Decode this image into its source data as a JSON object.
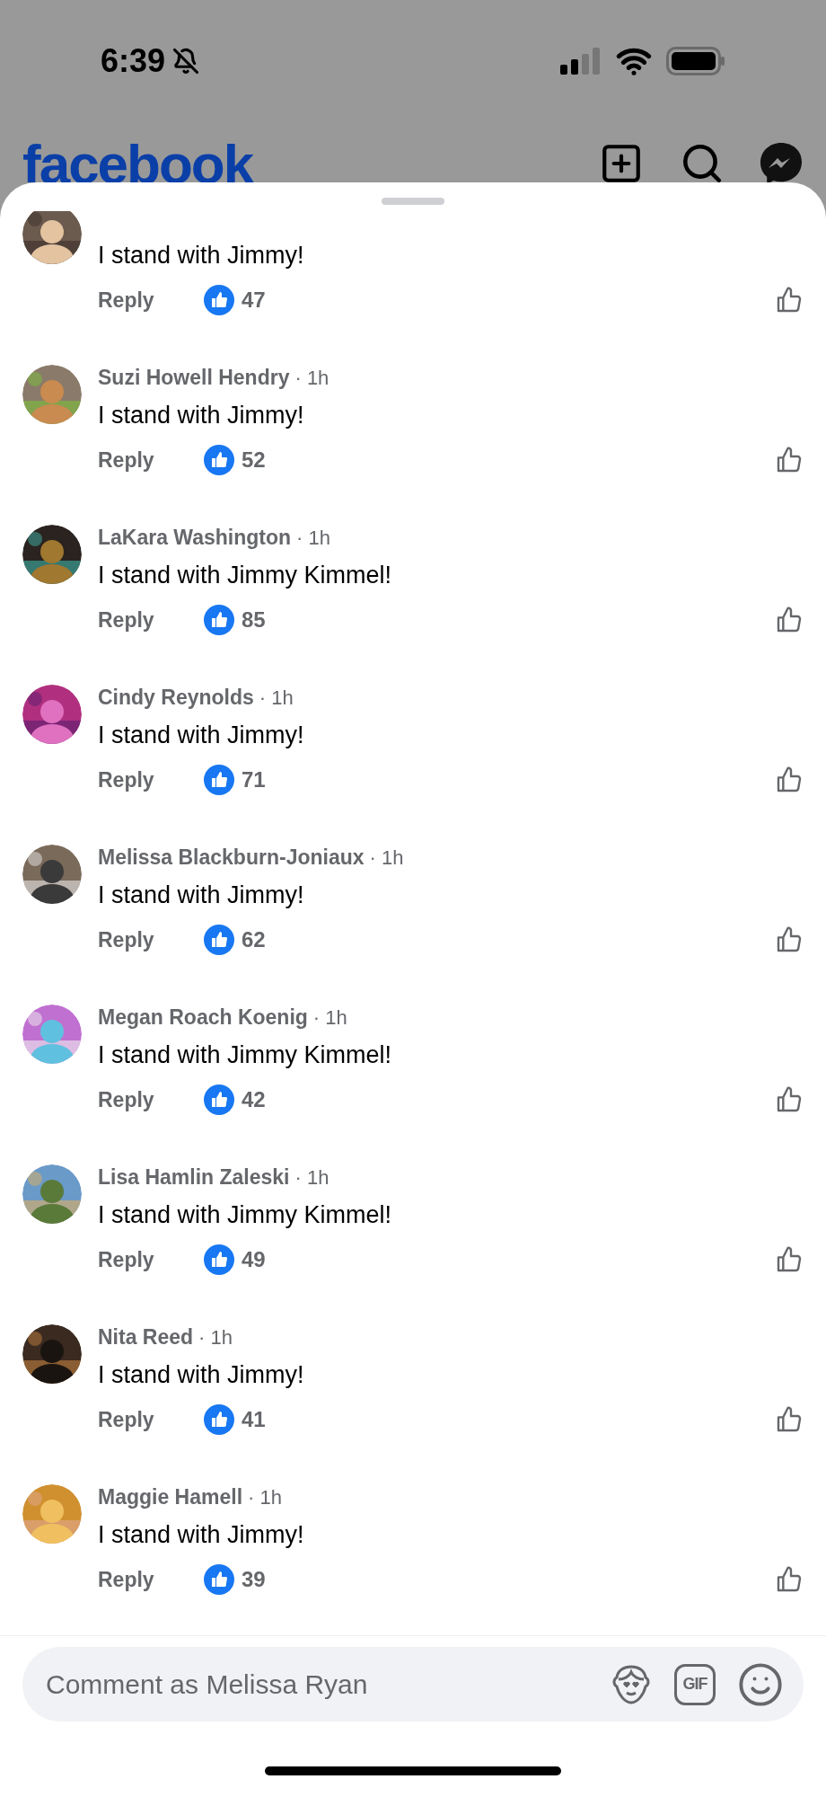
{
  "status_bar": {
    "time": "6:39"
  },
  "app_bar": {
    "logo": "facebook"
  },
  "comments": [
    {
      "text": "I stand with Jimmy!",
      "reply_label": "Reply",
      "likes": "47"
    },
    {
      "author": "Suzi Howell Hendry",
      "time_label": "· 1h",
      "text": "I stand with Jimmy!",
      "reply_label": "Reply",
      "likes": "52"
    },
    {
      "author": "LaKara Washington",
      "time_label": "· 1h",
      "text": "I stand with Jimmy Kimmel!",
      "reply_label": "Reply",
      "likes": "85"
    },
    {
      "author": "Cindy Reynolds",
      "time_label": "· 1h",
      "text": "I stand with Jimmy!",
      "reply_label": "Reply",
      "likes": "71"
    },
    {
      "author": "Melissa Blackburn-Joniaux",
      "time_label": "· 1h",
      "text": "I stand with Jimmy!",
      "reply_label": "Reply",
      "likes": "62"
    },
    {
      "author": "Megan Roach Koenig",
      "time_label": "· 1h",
      "text": "I stand with Jimmy Kimmel!",
      "reply_label": "Reply",
      "likes": "42"
    },
    {
      "author": "Lisa Hamlin Zaleski",
      "time_label": "· 1h",
      "text": "I stand with Jimmy Kimmel!",
      "reply_label": "Reply",
      "likes": "49"
    },
    {
      "author": "Nita Reed",
      "time_label": "· 1h",
      "text": "I stand with Jimmy!",
      "reply_label": "Reply",
      "likes": "41"
    },
    {
      "author": "Maggie Hamell",
      "time_label": "· 1h",
      "text": "I stand with Jimmy!",
      "reply_label": "Reply",
      "likes": "39"
    }
  ],
  "composer": {
    "placeholder": "Comment as Melissa Ryan",
    "gif_label": "GIF"
  }
}
